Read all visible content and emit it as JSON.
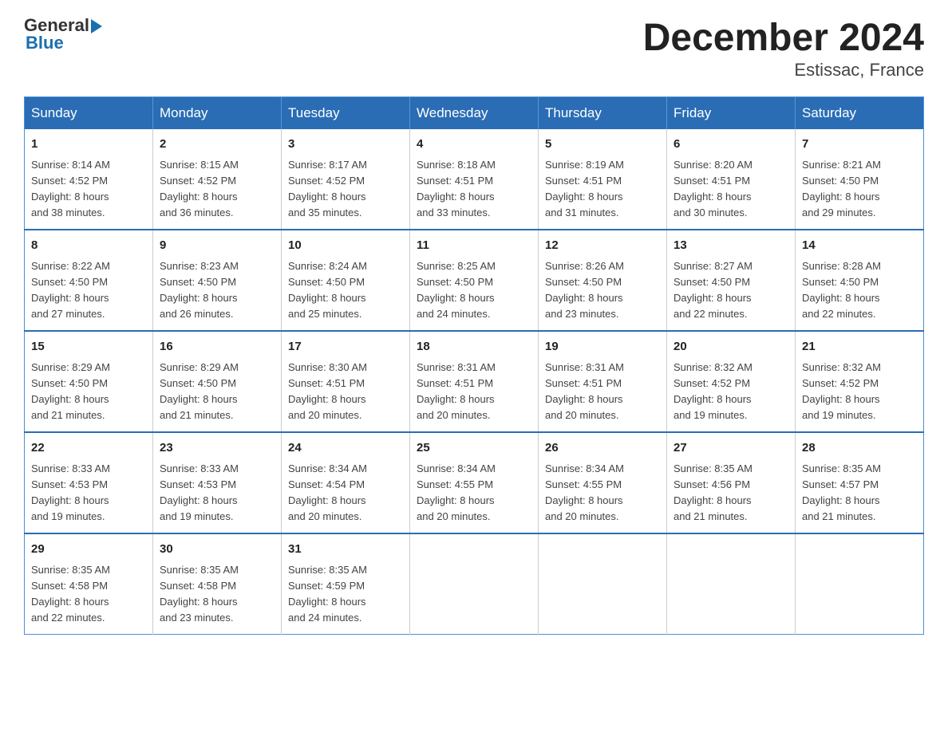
{
  "logo": {
    "text_general": "General",
    "text_blue": "Blue"
  },
  "title": "December 2024",
  "subtitle": "Estissac, France",
  "weekdays": [
    "Sunday",
    "Monday",
    "Tuesday",
    "Wednesday",
    "Thursday",
    "Friday",
    "Saturday"
  ],
  "weeks": [
    [
      {
        "day": "1",
        "sunrise": "8:14 AM",
        "sunset": "4:52 PM",
        "daylight": "8 hours and 38 minutes."
      },
      {
        "day": "2",
        "sunrise": "8:15 AM",
        "sunset": "4:52 PM",
        "daylight": "8 hours and 36 minutes."
      },
      {
        "day": "3",
        "sunrise": "8:17 AM",
        "sunset": "4:52 PM",
        "daylight": "8 hours and 35 minutes."
      },
      {
        "day": "4",
        "sunrise": "8:18 AM",
        "sunset": "4:51 PM",
        "daylight": "8 hours and 33 minutes."
      },
      {
        "day": "5",
        "sunrise": "8:19 AM",
        "sunset": "4:51 PM",
        "daylight": "8 hours and 31 minutes."
      },
      {
        "day": "6",
        "sunrise": "8:20 AM",
        "sunset": "4:51 PM",
        "daylight": "8 hours and 30 minutes."
      },
      {
        "day": "7",
        "sunrise": "8:21 AM",
        "sunset": "4:50 PM",
        "daylight": "8 hours and 29 minutes."
      }
    ],
    [
      {
        "day": "8",
        "sunrise": "8:22 AM",
        "sunset": "4:50 PM",
        "daylight": "8 hours and 27 minutes."
      },
      {
        "day": "9",
        "sunrise": "8:23 AM",
        "sunset": "4:50 PM",
        "daylight": "8 hours and 26 minutes."
      },
      {
        "day": "10",
        "sunrise": "8:24 AM",
        "sunset": "4:50 PM",
        "daylight": "8 hours and 25 minutes."
      },
      {
        "day": "11",
        "sunrise": "8:25 AM",
        "sunset": "4:50 PM",
        "daylight": "8 hours and 24 minutes."
      },
      {
        "day": "12",
        "sunrise": "8:26 AM",
        "sunset": "4:50 PM",
        "daylight": "8 hours and 23 minutes."
      },
      {
        "day": "13",
        "sunrise": "8:27 AM",
        "sunset": "4:50 PM",
        "daylight": "8 hours and 22 minutes."
      },
      {
        "day": "14",
        "sunrise": "8:28 AM",
        "sunset": "4:50 PM",
        "daylight": "8 hours and 22 minutes."
      }
    ],
    [
      {
        "day": "15",
        "sunrise": "8:29 AM",
        "sunset": "4:50 PM",
        "daylight": "8 hours and 21 minutes."
      },
      {
        "day": "16",
        "sunrise": "8:29 AM",
        "sunset": "4:50 PM",
        "daylight": "8 hours and 21 minutes."
      },
      {
        "day": "17",
        "sunrise": "8:30 AM",
        "sunset": "4:51 PM",
        "daylight": "8 hours and 20 minutes."
      },
      {
        "day": "18",
        "sunrise": "8:31 AM",
        "sunset": "4:51 PM",
        "daylight": "8 hours and 20 minutes."
      },
      {
        "day": "19",
        "sunrise": "8:31 AM",
        "sunset": "4:51 PM",
        "daylight": "8 hours and 20 minutes."
      },
      {
        "day": "20",
        "sunrise": "8:32 AM",
        "sunset": "4:52 PM",
        "daylight": "8 hours and 19 minutes."
      },
      {
        "day": "21",
        "sunrise": "8:32 AM",
        "sunset": "4:52 PM",
        "daylight": "8 hours and 19 minutes."
      }
    ],
    [
      {
        "day": "22",
        "sunrise": "8:33 AM",
        "sunset": "4:53 PM",
        "daylight": "8 hours and 19 minutes."
      },
      {
        "day": "23",
        "sunrise": "8:33 AM",
        "sunset": "4:53 PM",
        "daylight": "8 hours and 19 minutes."
      },
      {
        "day": "24",
        "sunrise": "8:34 AM",
        "sunset": "4:54 PM",
        "daylight": "8 hours and 20 minutes."
      },
      {
        "day": "25",
        "sunrise": "8:34 AM",
        "sunset": "4:55 PM",
        "daylight": "8 hours and 20 minutes."
      },
      {
        "day": "26",
        "sunrise": "8:34 AM",
        "sunset": "4:55 PM",
        "daylight": "8 hours and 20 minutes."
      },
      {
        "day": "27",
        "sunrise": "8:35 AM",
        "sunset": "4:56 PM",
        "daylight": "8 hours and 21 minutes."
      },
      {
        "day": "28",
        "sunrise": "8:35 AM",
        "sunset": "4:57 PM",
        "daylight": "8 hours and 21 minutes."
      }
    ],
    [
      {
        "day": "29",
        "sunrise": "8:35 AM",
        "sunset": "4:58 PM",
        "daylight": "8 hours and 22 minutes."
      },
      {
        "day": "30",
        "sunrise": "8:35 AM",
        "sunset": "4:58 PM",
        "daylight": "8 hours and 23 minutes."
      },
      {
        "day": "31",
        "sunrise": "8:35 AM",
        "sunset": "4:59 PM",
        "daylight": "8 hours and 24 minutes."
      },
      null,
      null,
      null,
      null
    ]
  ],
  "labels": {
    "sunrise": "Sunrise:",
    "sunset": "Sunset:",
    "daylight": "Daylight:"
  }
}
